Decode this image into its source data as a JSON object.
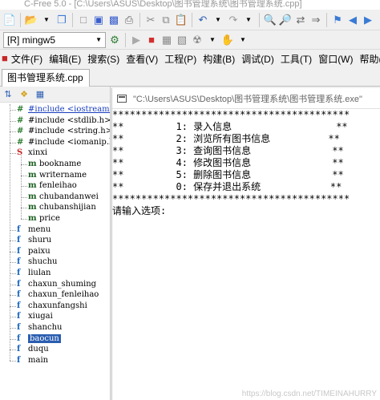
{
  "window": {
    "title": "C-Free 5.0 - [C:\\Users\\ASUS\\Desktop\\图书管理系统\\图书管理系统.cpp]"
  },
  "toolbar2": {
    "compiler_combo": "[R] mingw5"
  },
  "menu": {
    "items": [
      "文件(F)",
      "编辑(E)",
      "搜索(S)",
      "查看(V)",
      "工程(P)",
      "构建(B)",
      "调试(D)",
      "工具(T)",
      "窗口(W)",
      "帮助(H)"
    ]
  },
  "editor_tab": {
    "label": "图书管理系统.cpp"
  },
  "tree": {
    "includes": [
      "#include <iostream.h>",
      "#include <stdlib.h>",
      "#include <string.h>",
      "#include <iomanip.h>"
    ],
    "struct_name": "xinxi",
    "members": [
      "bookname",
      "writername",
      "fenleihao",
      "chubandanwei",
      "chubanshijian",
      "price"
    ],
    "functions": [
      "menu",
      "shuru",
      "paixu",
      "shuchu",
      "liulan",
      "chaxun_shuming",
      "chaxun_fenleihao",
      "chaxunfangshi",
      "xiugai",
      "shanchu",
      "baocun",
      "duqu",
      "main"
    ],
    "selected_function": "baocun"
  },
  "console": {
    "title": "\"C:\\Users\\ASUS\\Desktop\\图书管理系统\\图书管理系统.exe\"",
    "lines": [
      "*****************************************",
      "**         1: 录入信息                  **",
      "**         2: 浏览所有图书信息          **",
      "**         3: 查询图书信息              **",
      "**         4: 修改图书信息              **",
      "**         5: 删除图书信息              **",
      "**         0: 保存并退出系统            **",
      "*****************************************",
      "请输入选项:"
    ]
  },
  "watermark": {
    "text": "https://blog.csdn.net/TIMEINAHURRY"
  },
  "icons": {
    "include": "hash-icon",
    "struct": "struct-icon",
    "member": "member-icon",
    "function": "function-icon"
  },
  "colors": {
    "selection": "#2a5db0",
    "include_link": "#1a3dbd",
    "struct_icon": "#c62828",
    "member_icon": "#1b5e20",
    "function_icon": "#1565c0"
  }
}
